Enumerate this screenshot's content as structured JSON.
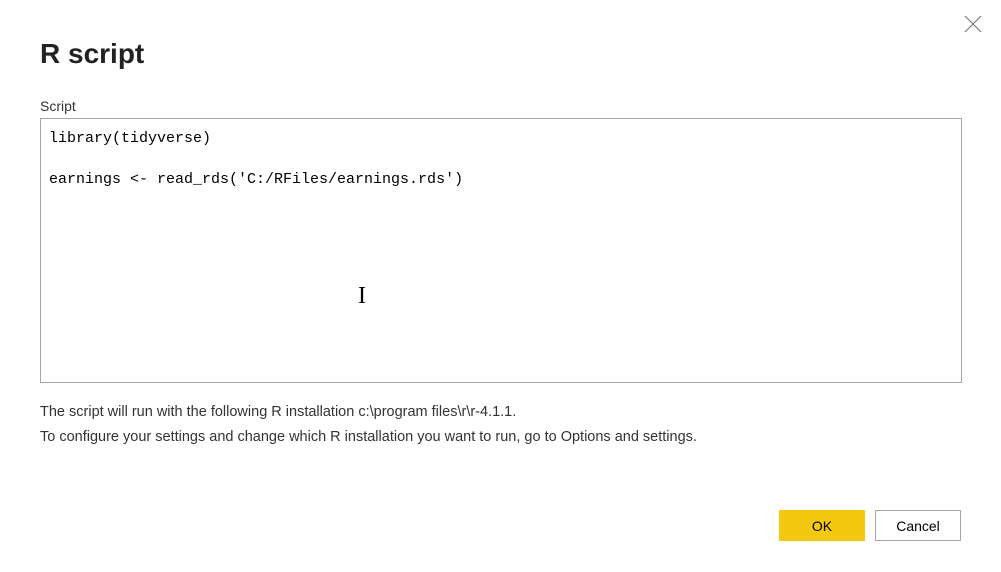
{
  "dialog": {
    "title": "R script",
    "field_label": "Script",
    "script_content": "library(tidyverse)\n\nearnings <- read_rds('C:/RFiles/earnings.rds')",
    "help_line1": "The script will run with the following R installation c:\\program files\\r\\r-4.1.1.",
    "help_line2": "To configure your settings and change which R installation you want to run, go to Options and settings.",
    "ok_label": "OK",
    "cancel_label": "Cancel"
  }
}
